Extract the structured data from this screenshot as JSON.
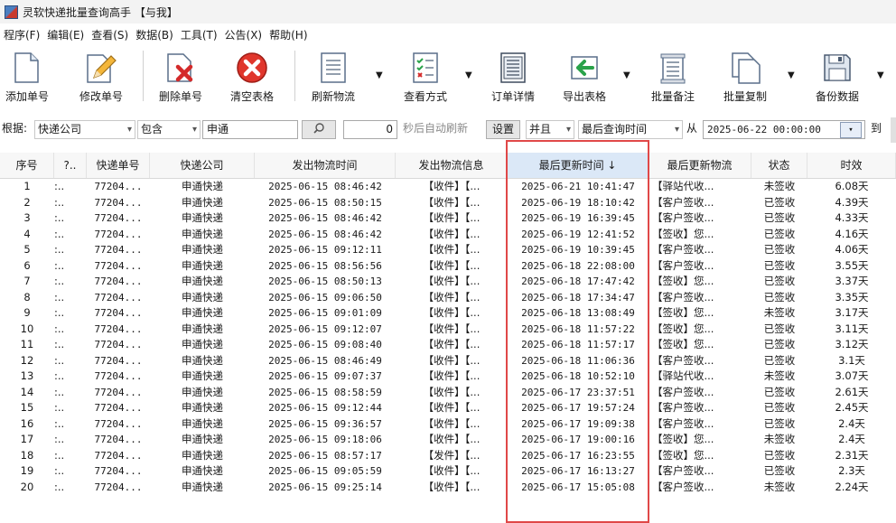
{
  "window": {
    "title": "灵软快递批量查询高手 【与我】"
  },
  "menu": [
    "程序(F)",
    "编辑(E)",
    "查看(S)",
    "数据(B)",
    "工具(T)",
    "公告(X)",
    "帮助(H)"
  ],
  "toolbar": {
    "add": "添加单号",
    "edit": "修改单号",
    "delete": "删除单号",
    "clear": "清空表格",
    "refresh": "刷新物流",
    "view_mode": "查看方式",
    "order_detail": "订单详情",
    "export": "导出表格",
    "batch_note": "批量备注",
    "batch_copy": "批量复制",
    "backup": "备份数据"
  },
  "filter": {
    "basis_label": "根据:",
    "field": "快递公司",
    "op": "包含",
    "value": "申通",
    "seconds": "0",
    "auto_refresh": "秒后自动刷新",
    "settings": "设置",
    "and": "并且",
    "field2": "最后查询时间",
    "from": "从",
    "date_from": "2025-06-22 00:00:00",
    "to": "到"
  },
  "columns": [
    "序号",
    "?..",
    "快递单号",
    "快递公司",
    "发出物流时间",
    "发出物流信息",
    "最后更新时间 ↓",
    "最后更新物流",
    "状态",
    "时效"
  ],
  "rows": [
    [
      "1",
      ":..",
      "77204...",
      "申通快递",
      "2025-06-15 08:46:42",
      "【收件】【...",
      "2025-06-21 10:41:47",
      "【驿站代收...",
      "未签收",
      "6.08天"
    ],
    [
      "2",
      ":..",
      "77204...",
      "申通快递",
      "2025-06-15 08:50:15",
      "【收件】【...",
      "2025-06-19 18:10:42",
      "【客户签收...",
      "已签收",
      "4.39天"
    ],
    [
      "3",
      ":..",
      "77204...",
      "申通快递",
      "2025-06-15 08:46:42",
      "【收件】【...",
      "2025-06-19 16:39:45",
      "【客户签收...",
      "已签收",
      "4.33天"
    ],
    [
      "4",
      ":..",
      "77204...",
      "申通快递",
      "2025-06-15 08:46:42",
      "【收件】【...",
      "2025-06-19 12:41:52",
      "【签收】您...",
      "已签收",
      "4.16天"
    ],
    [
      "5",
      ":..",
      "77204...",
      "申通快递",
      "2025-06-15 09:12:11",
      "【收件】【...",
      "2025-06-19 10:39:45",
      "【客户签收...",
      "已签收",
      "4.06天"
    ],
    [
      "6",
      ":..",
      "77204...",
      "申通快递",
      "2025-06-15 08:56:56",
      "【收件】【...",
      "2025-06-18 22:08:00",
      "【客户签收...",
      "已签收",
      "3.55天"
    ],
    [
      "7",
      ":..",
      "77204...",
      "申通快递",
      "2025-06-15 08:50:13",
      "【收件】【...",
      "2025-06-18 17:47:42",
      "【签收】您...",
      "已签收",
      "3.37天"
    ],
    [
      "8",
      ":..",
      "77204...",
      "申通快递",
      "2025-06-15 09:06:50",
      "【收件】【...",
      "2025-06-18 17:34:47",
      "【客户签收...",
      "已签收",
      "3.35天"
    ],
    [
      "9",
      ":..",
      "77204...",
      "申通快递",
      "2025-06-15 09:01:09",
      "【收件】【...",
      "2025-06-18 13:08:49",
      "【签收】您...",
      "未签收",
      "3.17天"
    ],
    [
      "10",
      ":..",
      "77204...",
      "申通快递",
      "2025-06-15 09:12:07",
      "【收件】【...",
      "2025-06-18 11:57:22",
      "【签收】您...",
      "已签收",
      "3.11天"
    ],
    [
      "11",
      ":..",
      "77204...",
      "申通快递",
      "2025-06-15 09:08:40",
      "【收件】【...",
      "2025-06-18 11:57:17",
      "【签收】您...",
      "已签收",
      "3.12天"
    ],
    [
      "12",
      ":..",
      "77204...",
      "申通快递",
      "2025-06-15 08:46:49",
      "【收件】【...",
      "2025-06-18 11:06:36",
      "【客户签收...",
      "已签收",
      "3.1天"
    ],
    [
      "13",
      ":..",
      "77204...",
      "申通快递",
      "2025-06-15 09:07:37",
      "【收件】【...",
      "2025-06-18 10:52:10",
      "【驿站代收...",
      "未签收",
      "3.07天"
    ],
    [
      "14",
      ":..",
      "77204...",
      "申通快递",
      "2025-06-15 08:58:59",
      "【收件】【...",
      "2025-06-17 23:37:51",
      "【客户签收...",
      "已签收",
      "2.61天"
    ],
    [
      "15",
      ":..",
      "77204...",
      "申通快递",
      "2025-06-15 09:12:44",
      "【收件】【...",
      "2025-06-17 19:57:24",
      "【客户签收...",
      "已签收",
      "2.45天"
    ],
    [
      "16",
      ":..",
      "77204...",
      "申通快递",
      "2025-06-15 09:36:57",
      "【收件】【...",
      "2025-06-17 19:09:38",
      "【客户签收...",
      "已签收",
      "2.4天"
    ],
    [
      "17",
      ":..",
      "77204...",
      "申通快递",
      "2025-06-15 09:18:06",
      "【收件】【...",
      "2025-06-17 19:00:16",
      "【签收】您...",
      "未签收",
      "2.4天"
    ],
    [
      "18",
      ":..",
      "77204...",
      "申通快递",
      "2025-06-15 08:57:17",
      "【发件】【...",
      "2025-06-17 16:23:55",
      "【签收】您...",
      "已签收",
      "2.31天"
    ],
    [
      "19",
      ":..",
      "77204...",
      "申通快递",
      "2025-06-15 09:05:59",
      "【收件】【...",
      "2025-06-17 16:13:27",
      "【客户签收...",
      "已签收",
      "2.3天"
    ],
    [
      "20",
      ":..",
      "77204...",
      "申通快递",
      "2025-06-15 09:25:14",
      "【收件】【...",
      "2025-06-17 15:05:08",
      "【客户签收...",
      "未签收",
      "2.24天"
    ]
  ]
}
